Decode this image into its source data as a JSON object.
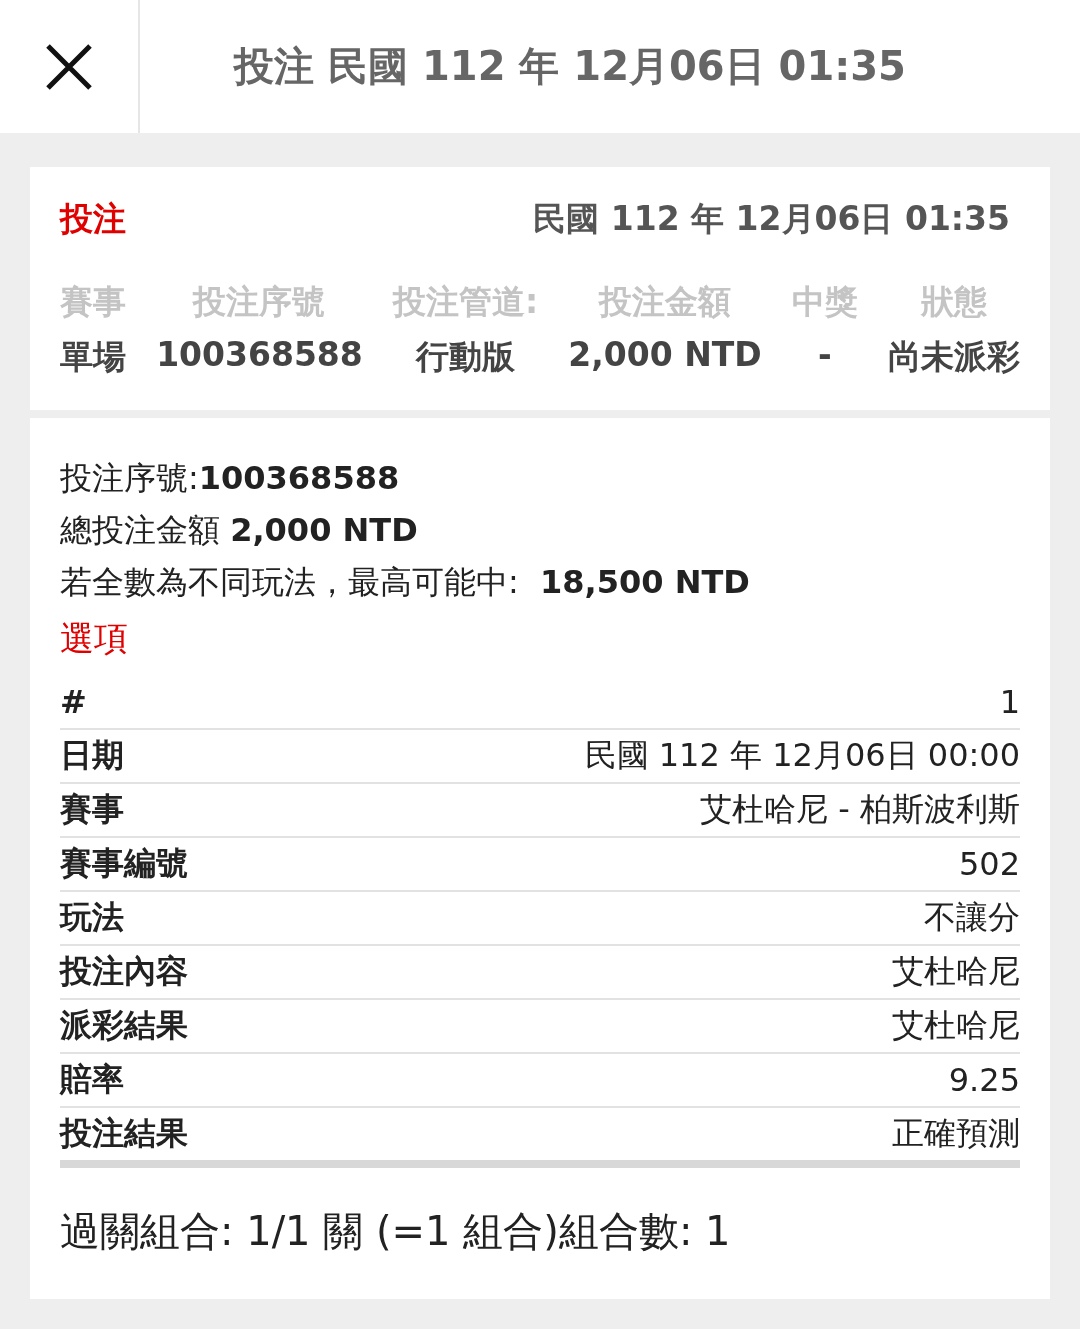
{
  "header": {
    "title": "投注 民國 112 年 12月06日 01:35"
  },
  "summary": {
    "label": "投注",
    "date": "民國 112 年 12月06日 01:35",
    "columns": [
      {
        "heading": "賽事",
        "value": "單場"
      },
      {
        "heading": "投注序號",
        "value": "100368588"
      },
      {
        "heading": "投注管道:",
        "value": "行動版"
      },
      {
        "heading": "投注金額",
        "value": "2,000 NTD"
      },
      {
        "heading": "中獎",
        "value": "-"
      },
      {
        "heading": "狀態",
        "value": "尚未派彩"
      }
    ]
  },
  "details": {
    "lines": [
      "投注序號:**100368588**",
      "總投注金額 **2,000 NTD**"
    ],
    "max_win": {
      "label": "若全數為不同玩法，最高可能中:",
      "value": "18,500 NTD"
    },
    "section_title": "選項",
    "rows": [
      {
        "label": "#",
        "value": "1"
      },
      {
        "label": "日期",
        "value": "民國 112 年 12月06日 00:00"
      },
      {
        "label": "賽事",
        "value": "艾杜哈尼 - 柏斯波利斯"
      },
      {
        "label": "賽事編號",
        "value": "502"
      },
      {
        "label": "玩法",
        "value": "不讓分"
      },
      {
        "label": "投注內容",
        "value": "艾杜哈尼"
      },
      {
        "label": "派彩結果",
        "value": "艾杜哈尼"
      },
      {
        "label": "賠率",
        "value": "9.25"
      },
      {
        "label": "投注結果",
        "value": "正確預測"
      }
    ],
    "footer": "過關組合: 1/1 關 (=1 組合)組合數: 1"
  }
}
